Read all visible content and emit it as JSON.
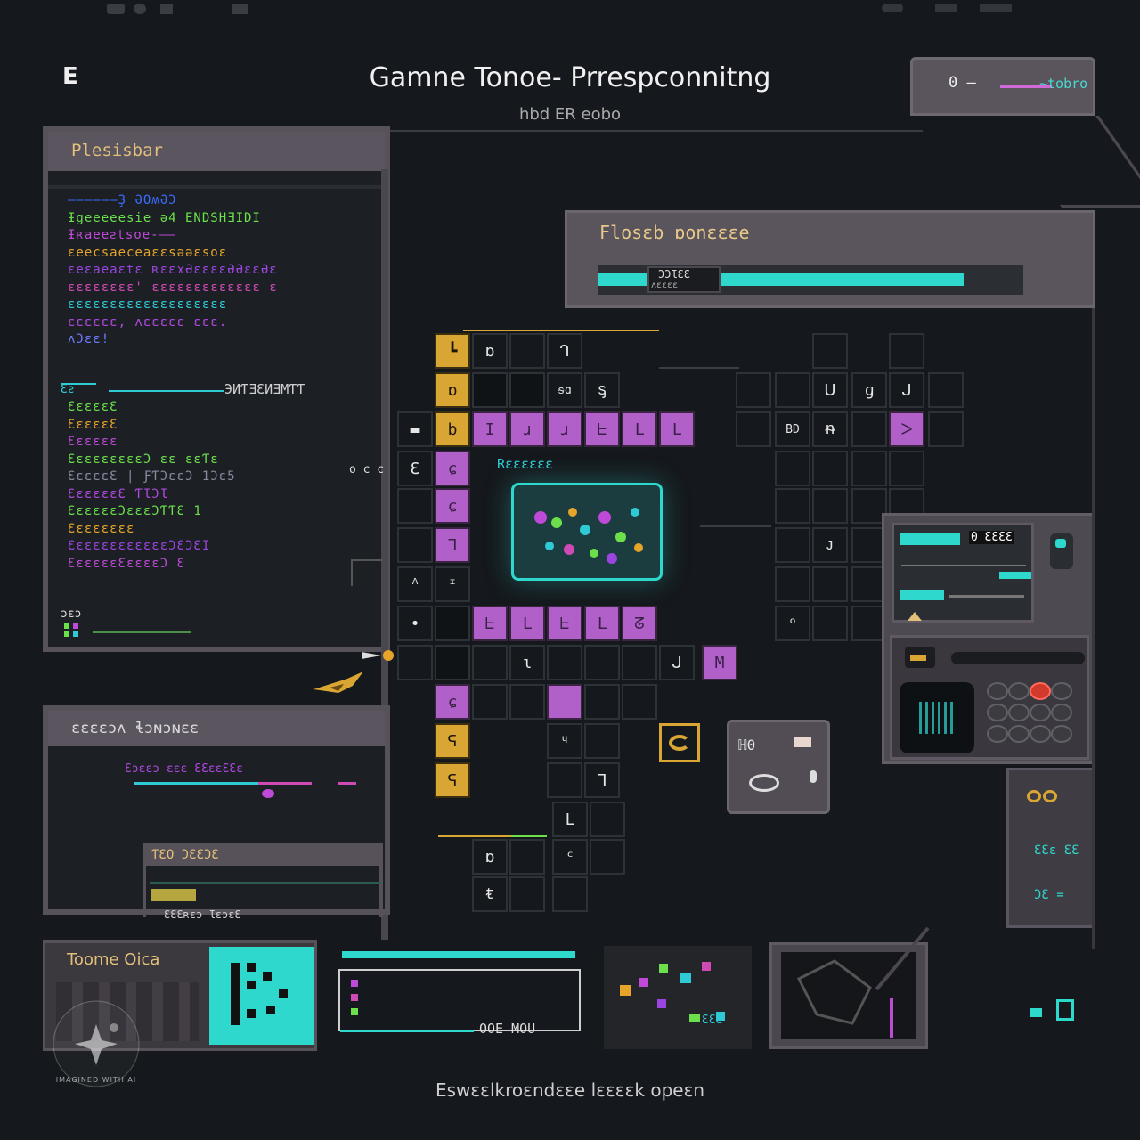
{
  "header": {
    "title": "Gamne Tonoe- Prrespconnitng",
    "subtitle": "hbd ER eobo",
    "logo_glyph": "E"
  },
  "top_right_widget": {
    "label": "0 —",
    "value": "~tobro"
  },
  "left_panel": {
    "title": "Plesisbar",
    "code_block_1": [
      {
        "text": "——————Ҙ ƏOʍƏƆ",
        "color": "#3b6bff"
      },
      {
        "text": "Ɨgeeeeesie ǝ4 ENDSHƎIDI",
        "color": "#6be04a"
      },
      {
        "text": "Ɨʀaeeꙅtsoe-——",
        "color": "#c04ad8"
      },
      {
        "text": "ɛeecsaeceaɛɛsəəɛsoɛ",
        "color": "#e6a52a"
      },
      {
        "text": "ɛeɛaeaɛtɛ ʀɛɛɤƏɛɛɛɛƏƏɛɛƏɛ",
        "color": "#9b45e0"
      },
      {
        "text": "ɛɛɛɛɛɛɛɛ' ɛɛɛɛɛɛɛɛɛɛɛɛɛ ɛ",
        "color": "#d04ab5"
      },
      {
        "text": "ɛɛɛɛɛɛɛɛɛɛɛɛɛɛɛɛɛɛɛ",
        "color": "#2ecbd6"
      },
      {
        "text": "ɛɛɛɛɛɛ, ʌɛɛɛɛɛ ɛɛɛ.",
        "color": "#b048e0"
      },
      {
        "text": "ʌƆɛɛ!",
        "color": "#6d7bff"
      }
    ],
    "divider_label": "ЭИƬƎƐИƎМƬƬ",
    "divider_prefix": "Ɛƨ",
    "code_block_2": [
      {
        "text": "ƐɛɛɛɛƐ",
        "color": "#6be04a"
      },
      {
        "text": "ƐɛɛɛɛƐ",
        "color": "#e6a52a"
      },
      {
        "text": "Ɛɛɛɛɛɛ",
        "color": "#c04ad8"
      },
      {
        "text": "ƐɛɛɛɛɛɛɛɛƆ ɛɛ ɛɛƬɛ",
        "color": "#6be04a"
      },
      {
        "text": "ƐɛɛɛɛƐ | ƑƬƆɛɛƆ 1Ɔɛ5",
        "color": "#8a8aa0"
      },
      {
        "text": "ƐɛɛɛɛɛƐ ƬƖƆƖ",
        "color": "#b048e0"
      },
      {
        "text": "ƐɛɛɛɛɛƆɛɛɛƆƬƬƐ 1",
        "color": "#6be04a"
      },
      {
        "text": "Ɛɛɛɛɛɛɛɛ",
        "color": "#e6a52a"
      },
      {
        "text": "ƐɛɛɛɛɛɛɛɛɛɛɛƆƐƆƐI",
        "color": "#9b45e0"
      },
      {
        "text": "ƐɛɛɛɛɛƐɛɛɛɛƆ Ɛ",
        "color": "#c04ad8"
      }
    ],
    "side_label": "o c c",
    "footer_label": "ɔɛɔ"
  },
  "left_lower_panel": {
    "title": "ɛɛɛɛɔʌ ɬɔɴɔɴɛɛ",
    "row_label": "Ɛɔɛɛɔ ɛɛɛ ƐƐɛɛƐƐɛ",
    "sub_panel_title": "ƬƐO ƆƐƐƆƐ",
    "footer_text": "ƐƐƐʀɛɔ ƖɛɔɛƐ"
  },
  "progress_panel": {
    "title": "Flosɛb ɒonɛɛɛe",
    "bar_label_top": "ƆƆƖƐƐ",
    "bar_label_bottom": "ʌɛɛɛɛ",
    "progress": 0.86
  },
  "grid": {
    "center_label": "Rɛɛɛɛɛɛ",
    "side_label_left": "ɛ",
    "row_label": "BD ɛɛ"
  },
  "right_console": {
    "display_label": "0 ƐƐƐƐ",
    "bar_1": 0.45,
    "bar_2": 0.33
  },
  "right_small_panel": {
    "label_1": "ƐƐɛ ƐƐ",
    "label_2": "ƆƐ ="
  },
  "bottom_cards": {
    "card_1_title": "Toome Oica",
    "card_2_label": "OOE MOU",
    "card_3_label": "ƐƐƐ"
  },
  "footer": {
    "caption": "Eswɛɛlkroɛndɛɛe lɛɛɛɛk opeɛn"
  },
  "watermark": {
    "text": "IMAGINED WITH AI"
  },
  "colors": {
    "accent_teal": "#2fd8cc",
    "accent_purple": "#b060c8",
    "accent_gold": "#d9a634",
    "panel_gray": "#57525a",
    "background": "#15181c"
  }
}
